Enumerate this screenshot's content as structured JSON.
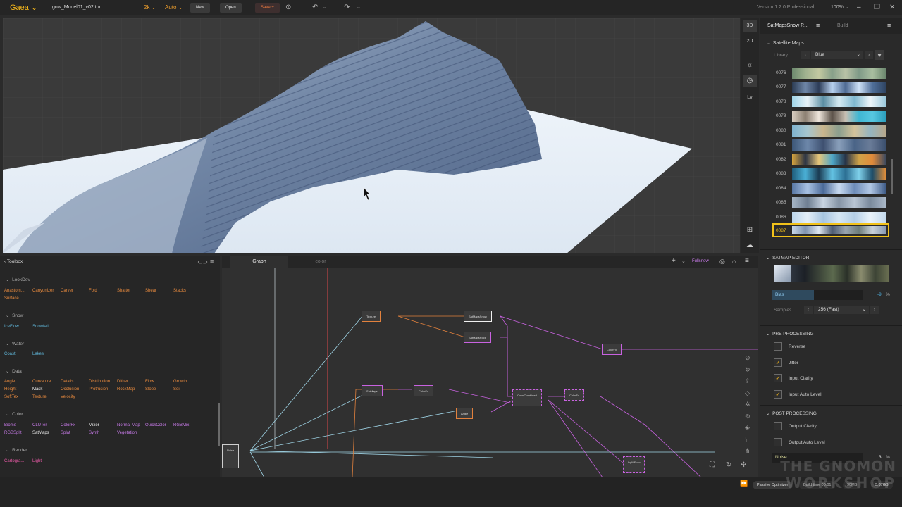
{
  "topbar": {
    "app": "Gaea",
    "file": "gnw_Model01_v02.tor",
    "resolution": "2k",
    "mode": "Auto",
    "new": "New",
    "open": "Open",
    "save": "Save +",
    "version": "Version 1.2.0 Professional",
    "zoom": "100%"
  },
  "viewport_tools": {
    "three_d": "3D",
    "two_d": "2D",
    "lv": "Lv"
  },
  "toolbox": {
    "title": "Toolbox",
    "categories": [
      {
        "name": "LookDev",
        "items": [
          "Anastom...",
          "Canyonizer",
          "Carver",
          "Fold",
          "Shatter",
          "Shear",
          "Stacks",
          "Surface"
        ]
      },
      {
        "name": "Snow",
        "items": [
          "IceFlow",
          "Snowfall"
        ]
      },
      {
        "name": "Water",
        "items": [
          "Coast",
          "Lakes"
        ]
      },
      {
        "name": "Data",
        "items": [
          "Angle",
          "Curvature",
          "Details",
          "Distribution",
          "Dither",
          "Flow",
          "Growth",
          "Height",
          "Mask",
          "Occlusion",
          "Protrusion",
          "RockMap",
          "Slope",
          "Soil",
          "SoftTex",
          "Texture",
          "Velocity"
        ]
      },
      {
        "name": "Color",
        "items": [
          "Biome",
          "CLUTer",
          "ColorFx",
          "Mixer",
          "Normal Map",
          "QuickColor",
          "RGBMix",
          "RGBSplit",
          "SatMaps",
          "Splat",
          "Synth",
          "Vegetation"
        ]
      },
      {
        "name": "Render",
        "items": [
          "Cartogra...",
          "Light"
        ]
      }
    ]
  },
  "graph": {
    "tabs": [
      "Graph",
      "color"
    ],
    "fullsnow": "Fullsnow",
    "nodes": [
      "Texture",
      "SatMapsSnow",
      "SatMapsRock",
      "ColorFx",
      "SatMaps",
      "ColorFx",
      "Angle",
      "ColorCombined",
      "ColorFx",
      "IcyWFlow",
      "Noise"
    ]
  },
  "right_panel": {
    "tab_active": "SatMapsSnow P...",
    "tab_build": "Build",
    "section_satellite": "Satellite Maps",
    "library_label": "Library",
    "library_value": "Blue",
    "swatches": [
      "0076",
      "0077",
      "0078",
      "0079",
      "0080",
      "0081",
      "0082",
      "0083",
      "0084",
      "0085",
      "0086",
      "0087"
    ],
    "selected_swatch": "0087",
    "satmap_editor": "SATMAP EDITOR",
    "bias_label": "Bias",
    "bias_value": "-9",
    "percent": "%",
    "samples_label": "Samples",
    "samples_value": "256 (Fast)",
    "pre_processing": "PRE PROCESSING",
    "pre_options": [
      {
        "label": "Reverse",
        "checked": false
      },
      {
        "label": "Jitter",
        "checked": true
      },
      {
        "label": "Input Clarity",
        "checked": true
      },
      {
        "label": "Input Auto Level",
        "checked": true
      }
    ],
    "post_processing": "POST PROCESSING",
    "post_options": [
      {
        "label": "Output Clarity",
        "checked": false
      },
      {
        "label": "Output Auto Level",
        "checked": false
      }
    ],
    "noise_label": "Noise",
    "noise_value": "3"
  },
  "status": {
    "passive": "Passive Optimizer",
    "build_time": "Build time 00:01",
    "mem1": "90MB",
    "mem2": "3.87GB"
  },
  "watermark": {
    "line1": "THE GNOMON",
    "line2": "WORKSHOP"
  },
  "colors": {
    "accent": "#f2b51a",
    "orange_wire": "#e2813d",
    "purple_wire": "#c862e0",
    "cyan_wire": "#9fd4e6"
  }
}
